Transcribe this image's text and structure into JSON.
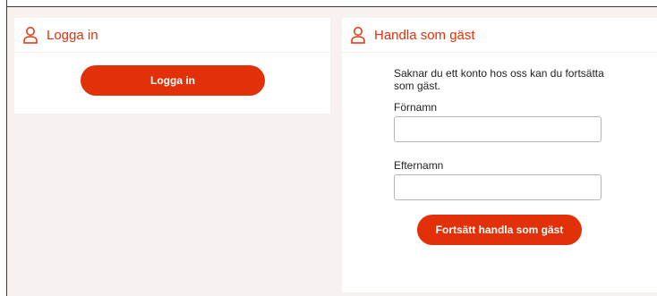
{
  "login": {
    "title": "Logga in",
    "button_label": "Logga in",
    "icon": "user-icon"
  },
  "guest": {
    "title": "Handla som gäst",
    "icon": "user-icon",
    "intro": "Saknar du ett konto hos oss kan du fortsätta som gäst.",
    "first_name_label": "Förnamn",
    "first_name_value": "",
    "last_name_label": "Efternamn",
    "last_name_value": "",
    "button_label": "Fortsätt handla som gäst"
  },
  "colors": {
    "accent": "#e23108",
    "page_bg": "#f7f1ef",
    "panel_bg": "#ffffff"
  }
}
